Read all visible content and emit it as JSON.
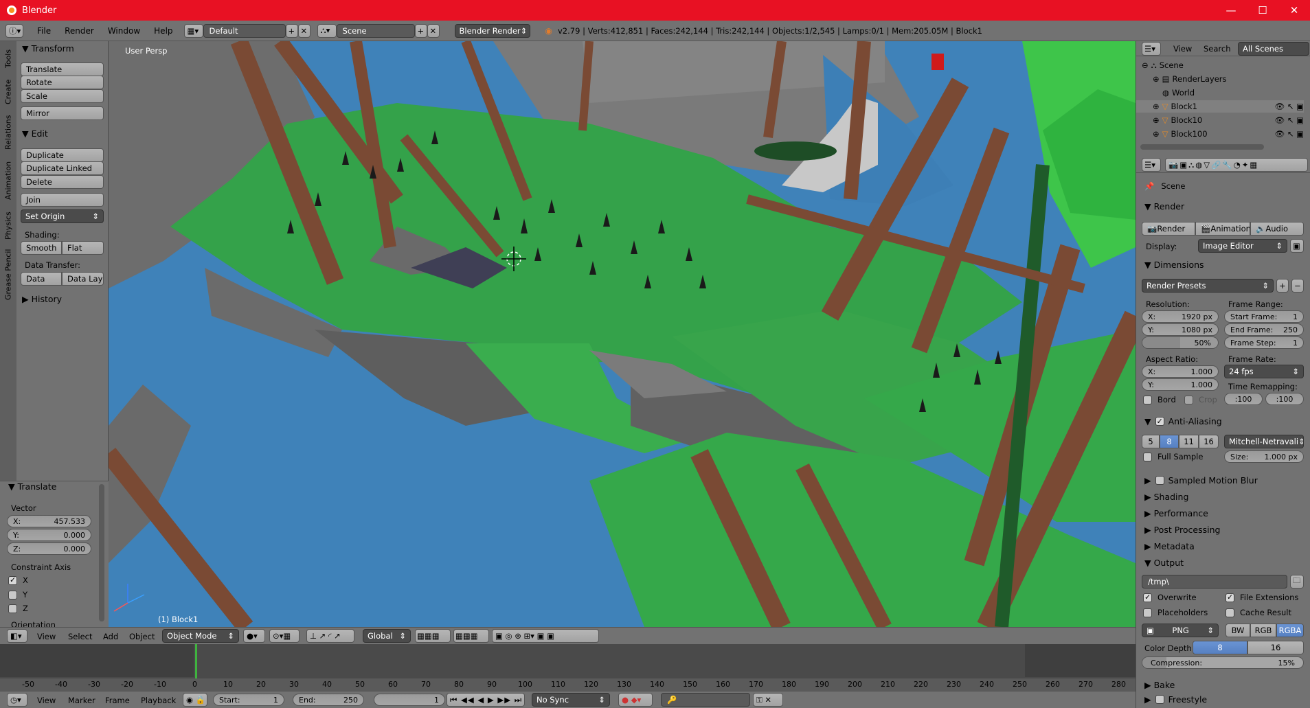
{
  "window": {
    "title": "Blender",
    "minimize": "—",
    "maximize": "☐",
    "close": "✕"
  },
  "menubar": {
    "items": [
      "File",
      "Render",
      "Window",
      "Help"
    ],
    "layout": "Default",
    "scene": "Scene",
    "engine": "Blender Render",
    "stats": "v2.79 | Verts:412,851 | Faces:242,144 | Tris:242,144 | Objects:1/2,545 | Lamps:0/1 | Mem:205.05M | Block1"
  },
  "toolshelf": {
    "tabs": [
      "Tools",
      "Create",
      "Relations",
      "Animation",
      "Physics",
      "Grease Pencil"
    ],
    "transform_header": "Transform",
    "translate": "Translate",
    "rotate": "Rotate",
    "scale": "Scale",
    "mirror": "Mirror",
    "edit_header": "Edit",
    "duplicate": "Duplicate",
    "duplicate_linked": "Duplicate Linked",
    "delete": "Delete",
    "join": "Join",
    "set_origin": "Set Origin",
    "shading_label": "Shading:",
    "smooth": "Smooth",
    "flat": "Flat",
    "data_transfer_label": "Data Transfer:",
    "data": "Data",
    "data_layo": "Data Layo",
    "history_header": "History"
  },
  "operator": {
    "header": "Translate",
    "vector_label": "Vector",
    "x_label": "X:",
    "x_val": "457.533",
    "y_label": "Y:",
    "y_val": "0.000",
    "z_label": "Z:",
    "z_val": "0.000",
    "constraint_label": "Constraint Axis",
    "cx": "X",
    "cy": "Y",
    "cz": "Z",
    "orientation_label": "Orientation"
  },
  "viewport": {
    "view_name": "User Persp",
    "object_name": "(1) Block1"
  },
  "vpheader": {
    "view": "View",
    "select": "Select",
    "add": "Add",
    "object": "Object",
    "mode": "Object Mode",
    "orientation": "Global"
  },
  "timeline": {
    "ticks": [
      "-50",
      "-40",
      "-30",
      "-20",
      "-10",
      "0",
      "10",
      "20",
      "30",
      "40",
      "50",
      "60",
      "70",
      "80",
      "90",
      "100",
      "110",
      "120",
      "130",
      "140",
      "150",
      "160",
      "170",
      "180",
      "190",
      "200",
      "210",
      "220",
      "230",
      "240",
      "250",
      "260",
      "270",
      "280"
    ],
    "view": "View",
    "marker": "Marker",
    "frame": "Frame",
    "playback": "Playback",
    "start_label": "Start:",
    "start_val": "1",
    "end_label": "End:",
    "end_val": "250",
    "current": "1",
    "sync": "No Sync"
  },
  "outliner": {
    "view": "View",
    "search": "Search",
    "scope": "All Scenes",
    "items": [
      "Scene",
      "RenderLayers",
      "World",
      "Block1",
      "Block10",
      "Block100"
    ]
  },
  "properties": {
    "context": "Scene",
    "render_header": "Render",
    "render_btn": "Render",
    "animation_btn": "Animation",
    "audio_btn": "Audio",
    "display_label": "Display:",
    "display_val": "Image Editor",
    "dimensions_header": "Dimensions",
    "render_presets": "Render Presets",
    "resolution_label": "Resolution:",
    "res_x_label": "X:",
    "res_x": "1920 px",
    "res_y_label": "Y:",
    "res_y": "1080 px",
    "res_pct": "50%",
    "frame_range_label": "Frame Range:",
    "start_frame_label": "Start Frame:",
    "start_frame": "1",
    "end_frame_label": "End Frame:",
    "end_frame": "250",
    "frame_step_label": "Frame Step:",
    "frame_step": "1",
    "aspect_label": "Aspect Ratio:",
    "asp_x_label": "X:",
    "asp_x": "1.000",
    "asp_y_label": "Y:",
    "asp_y": "1.000",
    "frame_rate_label": "Frame Rate:",
    "fps": "24 fps",
    "time_remap_label": "Time Remapping:",
    "remap_old": ":100",
    "remap_new": ":100",
    "bord": "Bord",
    "crop": "Crop",
    "aa_header": "Anti-Aliasing",
    "aa_samples": [
      "5",
      "8",
      "11",
      "16"
    ],
    "aa_filter": "Mitchell-Netravali",
    "full_sample": "Full Sample",
    "size_label": "Size:",
    "size_val": "1.000 px",
    "motion_blur": "Sampled Motion Blur",
    "shading": "Shading",
    "performance": "Performance",
    "post_processing": "Post Processing",
    "metadata": "Metadata",
    "output_header": "Output",
    "output_path": "/tmp\\",
    "overwrite": "Overwrite",
    "file_extensions": "File Extensions",
    "placeholders": "Placeholders",
    "cache_result": "Cache Result",
    "format": "PNG",
    "bw": "BW",
    "rgb": "RGB",
    "rgba": "RGBA",
    "color_depth_label": "Color Depth:",
    "depth_8": "8",
    "depth_16": "16",
    "compression_label": "Compression:",
    "compression_val": "15%",
    "bake": "Bake",
    "freestyle": "Freestyle"
  }
}
